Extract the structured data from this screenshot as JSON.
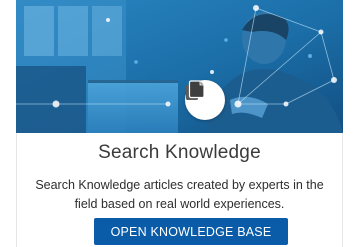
{
  "card": {
    "title": "Search Knowledge",
    "description": "Search Knowledge articles created by experts in the field based on real world experiences.",
    "button_label": "OPEN KNOWLEDGE BASE",
    "hero_icon": "copy-documents-icon",
    "colors": {
      "hero_tint": "#1d6fa6",
      "button_bg": "#0a5ba8",
      "title_text": "#3b3b3b"
    }
  }
}
